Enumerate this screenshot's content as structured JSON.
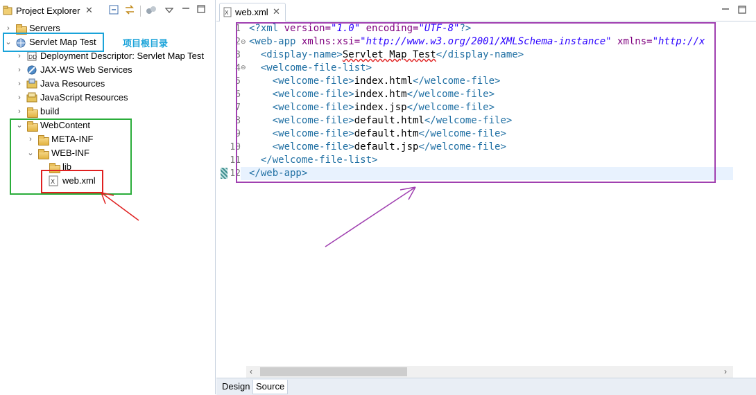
{
  "project_explorer": {
    "tab_title": "Project Explorer",
    "annotation": "项目根目录",
    "tree": [
      {
        "label": "Servers"
      },
      {
        "label": "Servlet Map Test"
      },
      {
        "label": "Deployment Descriptor: Servlet Map Test"
      },
      {
        "label": "JAX-WS Web Services"
      },
      {
        "label": "Java Resources"
      },
      {
        "label": "JavaScript Resources"
      },
      {
        "label": "build"
      },
      {
        "label": "WebContent"
      },
      {
        "label": "META-INF"
      },
      {
        "label": "WEB-INF"
      },
      {
        "label": "lib"
      },
      {
        "label": "web.xml"
      }
    ]
  },
  "editor": {
    "tab_title": "web.xml",
    "line_numbers": [
      "1",
      "2",
      "3",
      "4",
      "5",
      "6",
      "7",
      "8",
      "9",
      "10",
      "11",
      "12"
    ],
    "lines": [
      {
        "parts": [
          {
            "t": "<?xml ",
            "c": "tg"
          },
          {
            "t": "version=",
            "c": "at"
          },
          {
            "t": "\"1.0\"",
            "c": "av"
          },
          {
            "t": " encoding=",
            "c": "at"
          },
          {
            "t": "\"UTF-8\"",
            "c": "av"
          },
          {
            "t": "?>",
            "c": "tg"
          }
        ]
      },
      {
        "parts": [
          {
            "t": "<web-app ",
            "c": "tg"
          },
          {
            "t": "xmlns:xsi=",
            "c": "at"
          },
          {
            "t": "\"http://www.w3.org/2001/XMLSchema-instance\"",
            "c": "av"
          },
          {
            "t": " xmlns=",
            "c": "at"
          },
          {
            "t": "\"http://x",
            "c": "av"
          }
        ]
      },
      {
        "parts": [
          {
            "t": "  <display-name>",
            "c": "tg"
          },
          {
            "t": "Servlet Map Test",
            "c": "tx"
          },
          {
            "t": "</display-name>",
            "c": "tg"
          }
        ]
      },
      {
        "parts": [
          {
            "t": "  <welcome-file-list>",
            "c": "tg"
          }
        ]
      },
      {
        "parts": [
          {
            "t": "    <welcome-file>",
            "c": "tg"
          },
          {
            "t": "index.html",
            "c": "tx"
          },
          {
            "t": "</welcome-file>",
            "c": "tg"
          }
        ]
      },
      {
        "parts": [
          {
            "t": "    <welcome-file>",
            "c": "tg"
          },
          {
            "t": "index.htm",
            "c": "tx"
          },
          {
            "t": "</welcome-file>",
            "c": "tg"
          }
        ]
      },
      {
        "parts": [
          {
            "t": "    <welcome-file>",
            "c": "tg"
          },
          {
            "t": "index.jsp",
            "c": "tx"
          },
          {
            "t": "</welcome-file>",
            "c": "tg"
          }
        ]
      },
      {
        "parts": [
          {
            "t": "    <welcome-file>",
            "c": "tg"
          },
          {
            "t": "default.html",
            "c": "tx"
          },
          {
            "t": "</welcome-file>",
            "c": "tg"
          }
        ]
      },
      {
        "parts": [
          {
            "t": "    <welcome-file>",
            "c": "tg"
          },
          {
            "t": "default.htm",
            "c": "tx"
          },
          {
            "t": "</welcome-file>",
            "c": "tg"
          }
        ]
      },
      {
        "parts": [
          {
            "t": "    <welcome-file>",
            "c": "tg"
          },
          {
            "t": "default.jsp",
            "c": "tx"
          },
          {
            "t": "</welcome-file>",
            "c": "tg"
          }
        ]
      },
      {
        "parts": [
          {
            "t": "  </welcome-file-list>",
            "c": "tg"
          }
        ]
      },
      {
        "parts": [
          {
            "t": "</web-app>",
            "c": "tg"
          }
        ]
      }
    ]
  },
  "bottom_tabs": {
    "design": "Design",
    "source": "Source"
  },
  "colors": {
    "highlight_blue": "#1aa3d9",
    "highlight_green": "#2aad3a",
    "highlight_red": "#e02020",
    "highlight_purple": "#a040b0",
    "annotation_text": "#1aa3d9"
  }
}
